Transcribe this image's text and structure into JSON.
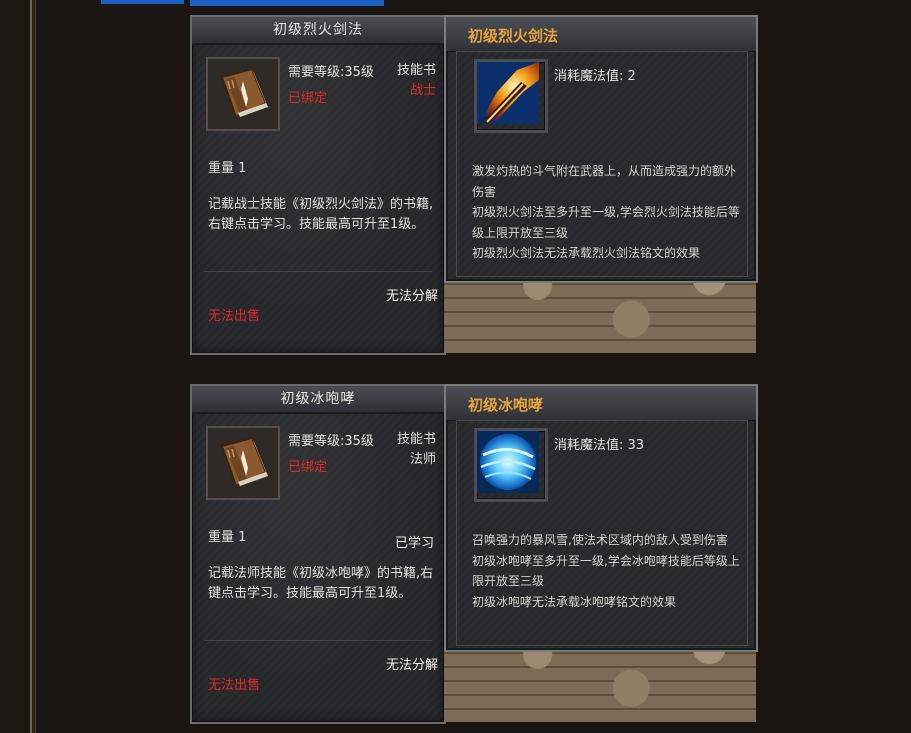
{
  "cards": [
    {
      "item": {
        "title": "初级烈火剑法",
        "level_req": "需要等级:35级",
        "bound": "已绑定",
        "type": "技能书",
        "class": "战士",
        "weight": "重量 1",
        "learned": "",
        "description": "记载战士技能《初级烈火剑法》的书籍,右键点击学习。技能最高可升至1级。",
        "no_decompose": "无法分解",
        "no_sell": "无法出售",
        "icon": "skill-book-icon"
      },
      "skill": {
        "name": "初级烈火剑法",
        "mana": "消耗魔法值: 2",
        "icon": "flame-sword-icon",
        "desc": [
          "激发灼热的斗气附在武器上，从而造成强力的额外伤害",
          "初级烈火剑法至多升至一级,学会烈火剑法技能后等级上限开放至三级",
          "初级烈火剑法无法承载烈火剑法铭文的效果"
        ]
      }
    },
    {
      "item": {
        "title": "初级冰咆哮",
        "level_req": "需要等级:35级",
        "bound": "已绑定",
        "type": "技能书",
        "class": "法师",
        "weight": "重量 1",
        "learned": "已学习",
        "description": "记载法师技能《初级冰咆哮》的书籍,右键点击学习。技能最高可升至1级。",
        "no_decompose": "无法分解",
        "no_sell": "无法出售",
        "icon": "skill-book-icon"
      },
      "skill": {
        "name": "初级冰咆哮",
        "mana": "消耗魔法值: 33",
        "icon": "ice-storm-icon",
        "desc": [
          "召唤强力的暴风雪,使法术区域内的敌人受到伤害",
          "初级冰咆哮至多升至一级,学会冰咆哮技能后等级上限开放至三级",
          "初级冰咆哮无法承载冰咆哮铭文的效果"
        ]
      }
    }
  ],
  "colors": {
    "skill_title": "#e8a33a",
    "warning_red": "#e0282a",
    "tab_blue": "#1c5fc6"
  }
}
